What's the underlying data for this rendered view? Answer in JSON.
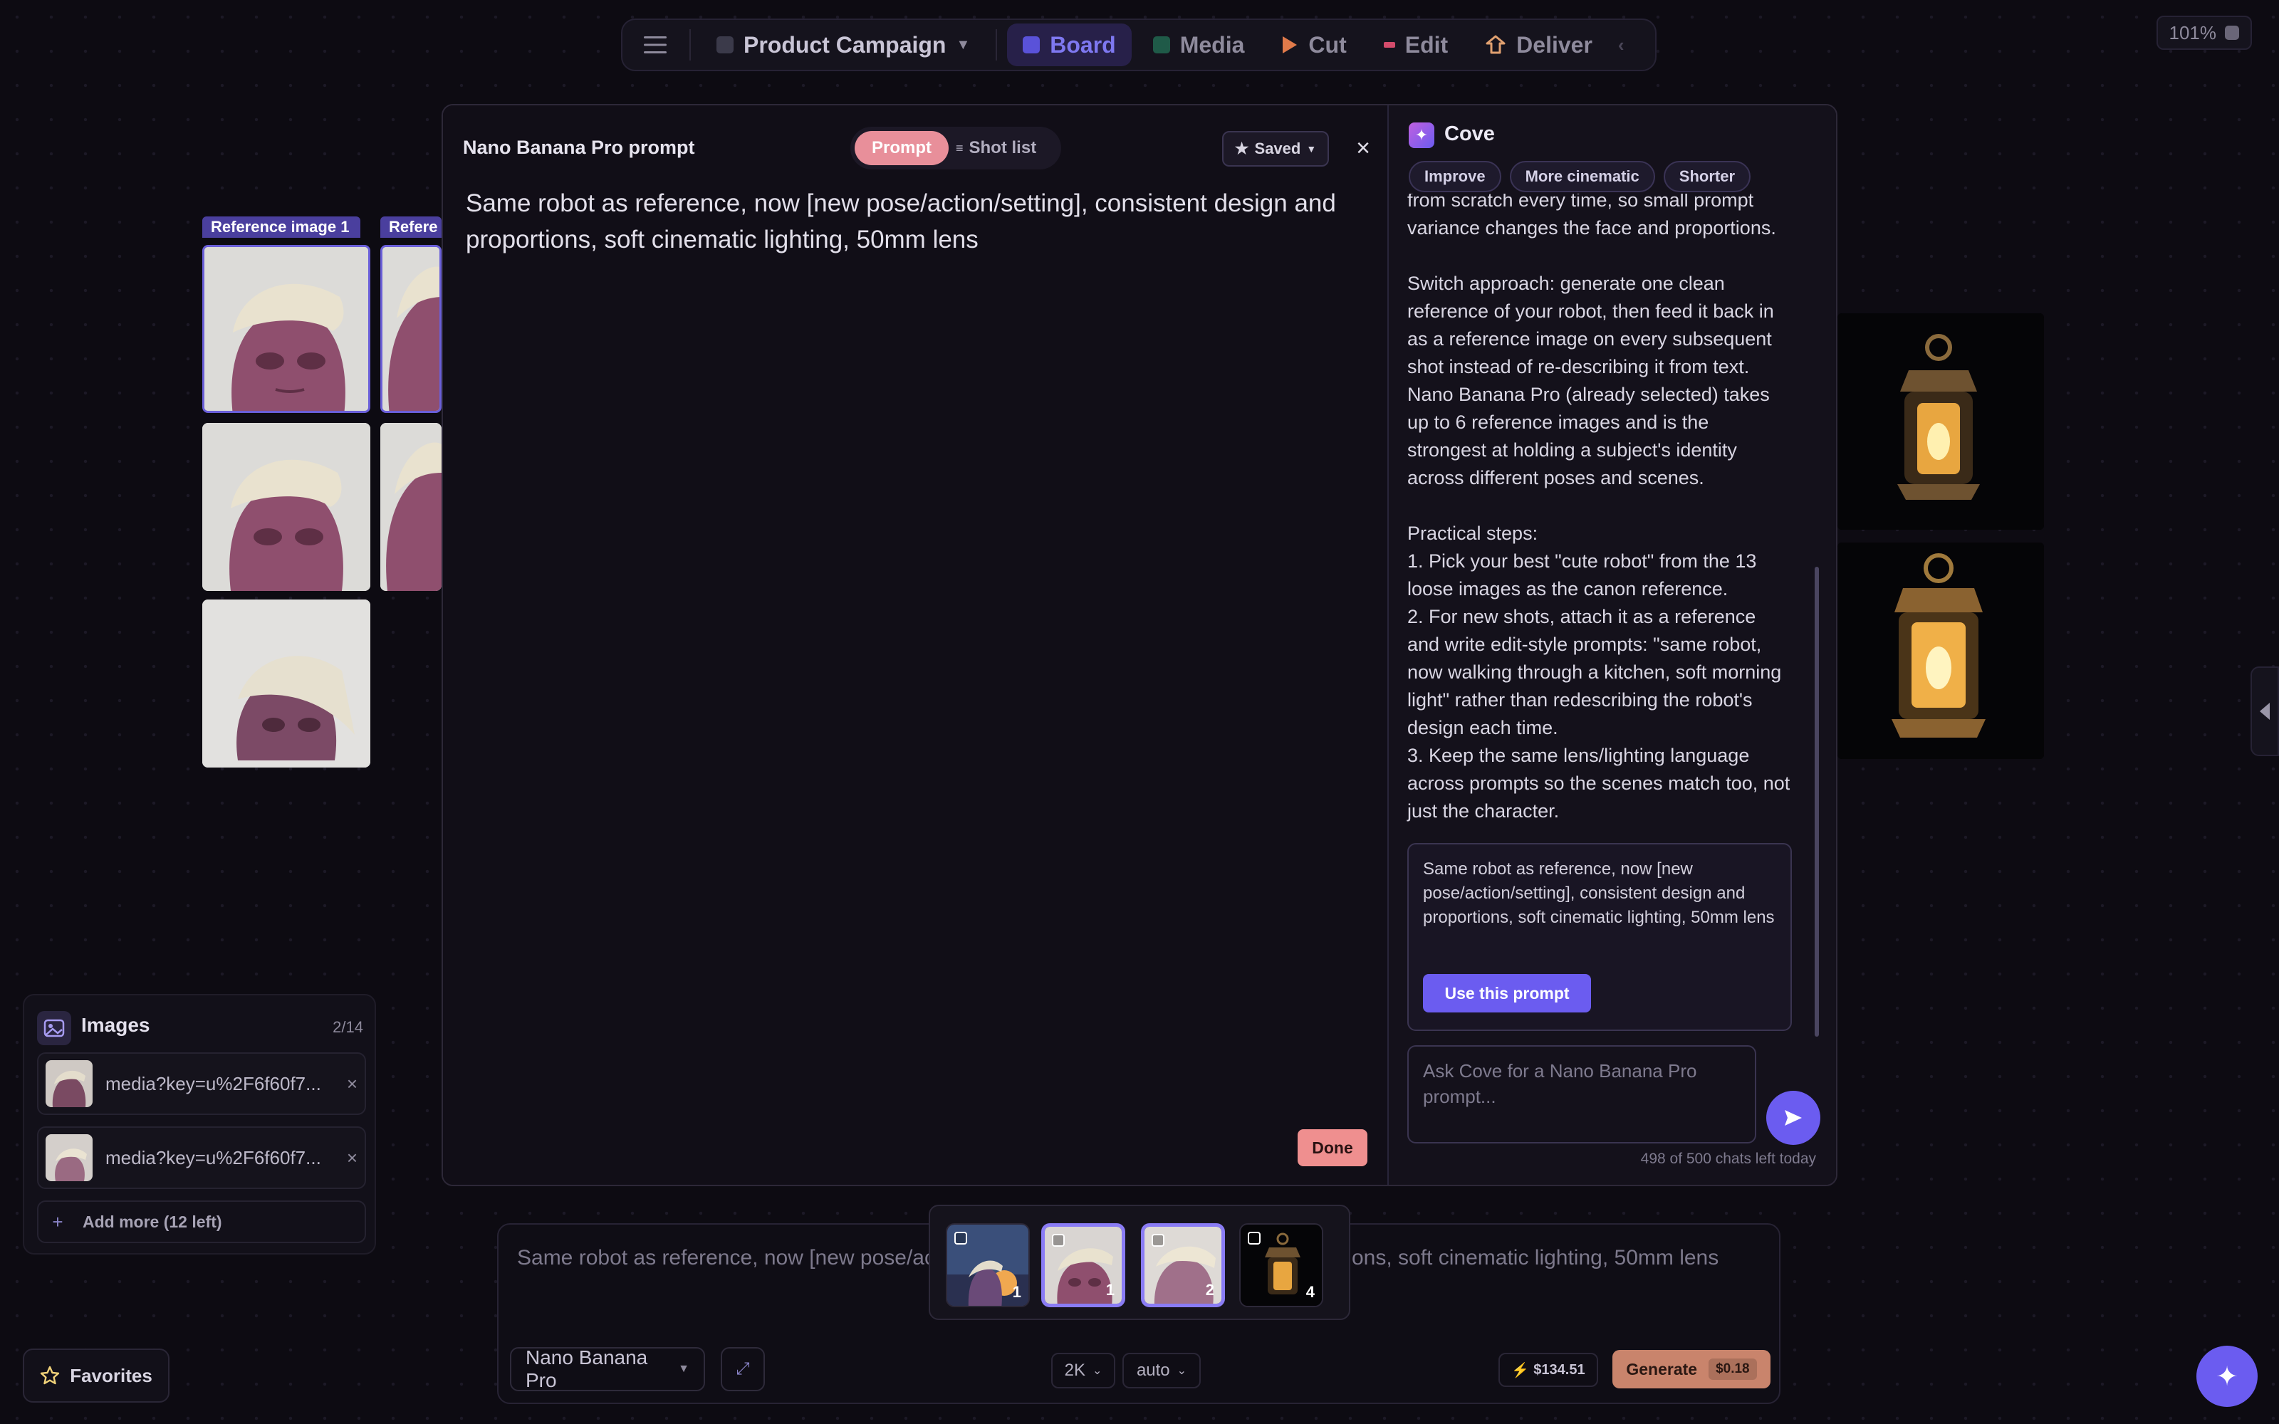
{
  "topnav": {
    "project": "Product Campaign",
    "tabs": [
      {
        "label": "Board",
        "icon": "board-icon"
      },
      {
        "label": "Media",
        "icon": "media-icon"
      },
      {
        "label": "Cut",
        "icon": "play-icon"
      },
      {
        "label": "Edit",
        "icon": "edit-icon"
      },
      {
        "label": "Deliver",
        "icon": "deliver-icon"
      }
    ],
    "zoom": "101%"
  },
  "board": {
    "ref_tags": [
      "Reference image 1",
      "Refere"
    ]
  },
  "images_panel": {
    "title": "Images",
    "count": "2/14",
    "items": [
      {
        "name": "media?key=u%2F6f60f7..."
      },
      {
        "name": "media?key=u%2F6f60f7..."
      }
    ],
    "add_more": "Add more (12 left)"
  },
  "favorites": {
    "label": "Favorites"
  },
  "modal": {
    "title": "Nano Banana Pro prompt",
    "tab_prompt": "Prompt",
    "tab_shotlist": "Shot list",
    "saved": "Saved",
    "close": "×",
    "prompt_text": "Same robot as reference, now [new pose/action/setting], consistent design and proportions, soft cinematic lighting, 50mm lens",
    "done": "Done"
  },
  "cove": {
    "title": "Cove",
    "chips": [
      "Improve",
      "More cinematic",
      "Shorter"
    ],
    "message": "from scratch every time, so small prompt variance changes the face and proportions.\n\nSwitch approach: generate one clean reference of your robot, then feed it back in as a reference image on every subsequent shot instead of re-describing it from text. Nano Banana Pro (already selected) takes up to 6 reference images and is the strongest at holding a subject's identity across different poses and scenes.\n\nPractical steps:\n1. Pick your best \"cute robot\" from the 13 loose images as the canon reference.\n2. For new shots, attach it as a reference and write edit-style prompts: \"same robot, now walking through a kitchen, soft morning light\" rather than redescribing the robot's design each time.\n3. Keep the same lens/lighting language across prompts so the scenes match too, not just the character.",
    "suggestion": "Same robot as reference, now [new pose/action/setting], consistent design and proportions, soft cinematic lighting, 50mm lens",
    "use_prompt": "Use this prompt",
    "input_placeholder": "Ask Cove for a Nano Banana Pro prompt...",
    "quota": "498 of 500 chats left today"
  },
  "bottom": {
    "prompt_left": "Same robot as reference, now [new pose/ac",
    "prompt_right": "ons, soft cinematic lighting, 50mm lens",
    "model": "Nano Banana Pro",
    "resolution": "2K",
    "aspect": "auto",
    "credits": "$134.51",
    "generate": "Generate",
    "cost": "$0.18"
  },
  "thumbs": [
    {
      "num": "1"
    },
    {
      "num": "1"
    },
    {
      "num": "2"
    },
    {
      "num": "4"
    }
  ],
  "colors": {
    "accent": "#6b5cf0",
    "generate": "#d98a6e",
    "done": "#ef8f8f"
  }
}
